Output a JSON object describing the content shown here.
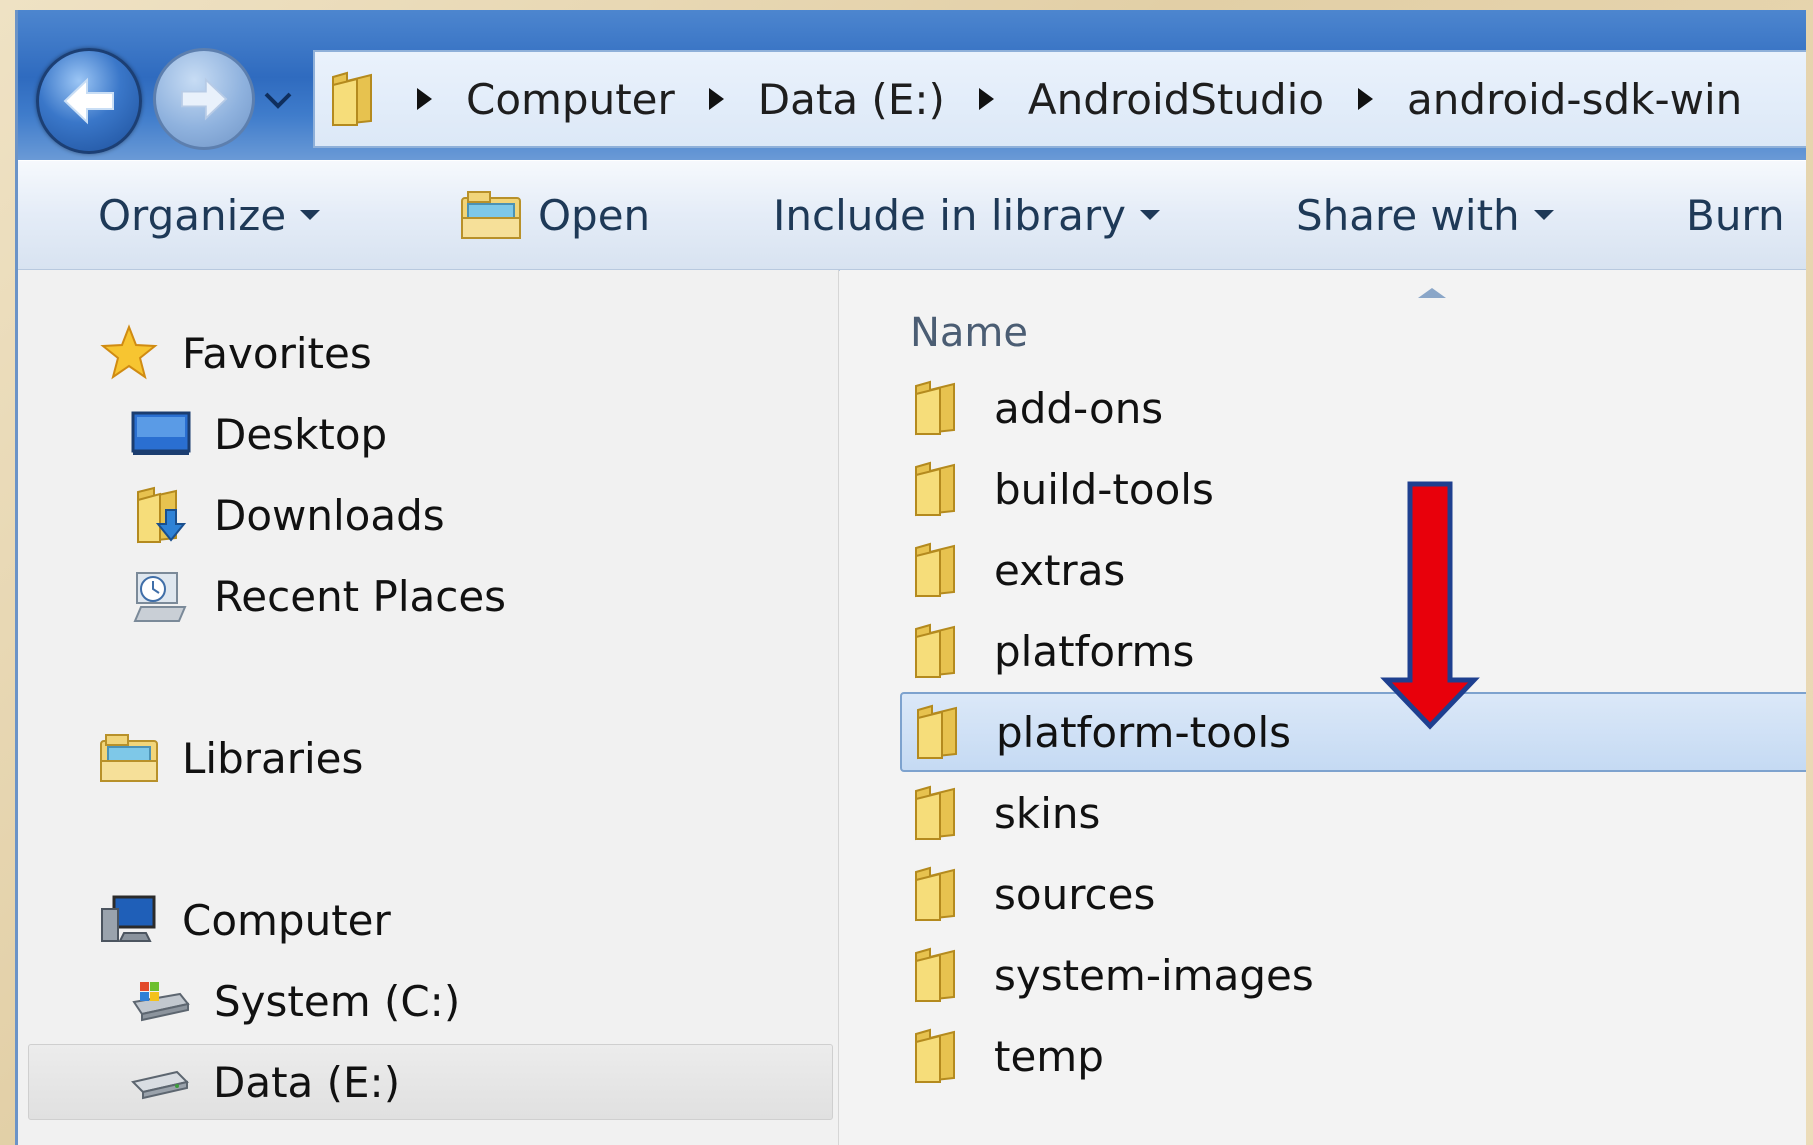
{
  "address_bar": {
    "crumbs": [
      "Computer",
      "Data (E:)",
      "AndroidStudio",
      "android-sdk-win"
    ]
  },
  "command_bar": {
    "organize": "Organize",
    "open": "Open",
    "include_in_library": "Include in library",
    "share_with": "Share with",
    "burn": "Burn"
  },
  "nav_pane": {
    "favorites": "Favorites",
    "desktop": "Desktop",
    "downloads": "Downloads",
    "recent_places": "Recent Places",
    "libraries": "Libraries",
    "computer": "Computer",
    "system_c": "System (C:)",
    "data_e": "Data (E:)"
  },
  "file_list": {
    "column_name": "Name",
    "items": [
      "add-ons",
      "build-tools",
      "extras",
      "platforms",
      "platform-tools",
      "skins",
      "sources",
      "system-images",
      "temp"
    ],
    "selected": "platform-tools"
  },
  "colors": {
    "annotation_arrow": "#e8000b",
    "selection": "#c5daf3"
  }
}
